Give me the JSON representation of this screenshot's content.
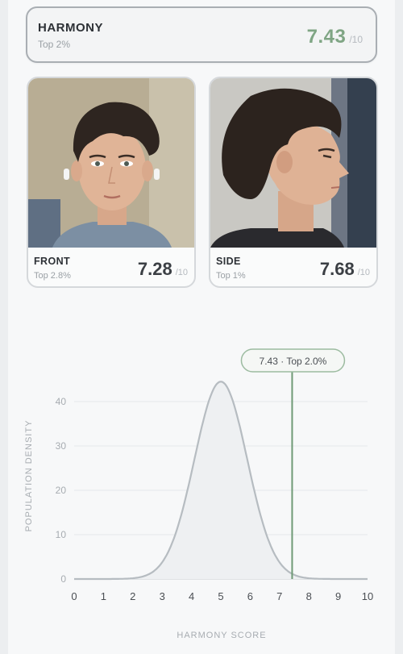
{
  "harmony": {
    "title": "HARMONY",
    "rank": "Top 2%",
    "score": "7.43",
    "out_of": "/10"
  },
  "cards": [
    {
      "label": "FRONT",
      "rank": "Top 2.8%",
      "score": "7.28",
      "out_of": "/10"
    },
    {
      "label": "SIDE",
      "rank": "Top 1%",
      "score": "7.68",
      "out_of": "/10"
    }
  ],
  "colors": {
    "accent": "#7fa584",
    "marker": "#6f9a76",
    "curve": "#b6bcc1"
  },
  "chart_data": {
    "type": "area",
    "xlabel": "HARMONY SCORE",
    "ylabel": "POPULATION DENSITY",
    "xlim": [
      0,
      10
    ],
    "ylim": [
      0,
      40
    ],
    "x_ticks": [
      "0",
      "1",
      "2",
      "3",
      "4",
      "5",
      "6",
      "7",
      "8",
      "9",
      "10"
    ],
    "y_ticks": [
      "0",
      "10",
      "20",
      "30",
      "40"
    ],
    "grid": true,
    "distribution": {
      "mean": 5.0,
      "std": 0.9,
      "peak": 44.5
    },
    "marker": {
      "x": 7.43,
      "label": "7.43 · Top 2.0%"
    }
  }
}
